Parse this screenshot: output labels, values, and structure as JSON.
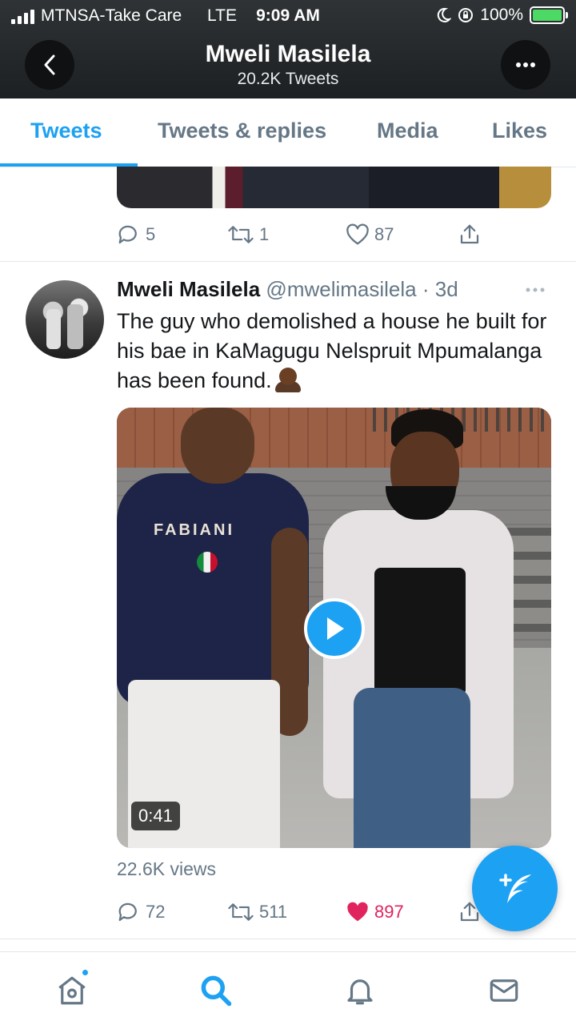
{
  "status_bar": {
    "carrier": "MTNSA-Take Care",
    "network": "LTE",
    "time": "9:09 AM",
    "battery": "100%"
  },
  "header": {
    "name": "Mweli Masilela",
    "tweet_count": "20.2K Tweets"
  },
  "tabs": [
    {
      "label": "Tweets",
      "active": true
    },
    {
      "label": "Tweets & replies",
      "active": false
    },
    {
      "label": "Media",
      "active": false
    },
    {
      "label": "Likes",
      "active": false
    }
  ],
  "previous_tweet": {
    "replies": "5",
    "retweets": "1",
    "likes": "87"
  },
  "tweet": {
    "author_name": "Mweli Masilela",
    "meta": "@mwelimasilela · 3d",
    "text": "The guy who demolished a house he built for his bae in KaMagugu Nelspruit Mpumalanga has been found.",
    "video": {
      "duration": "0:41",
      "shirt_brand": "FABIANI"
    },
    "views": "22.6K views",
    "replies": "72",
    "retweets": "511",
    "likes": "897",
    "liked": true
  },
  "colors": {
    "accent": "#1da1f2",
    "like": "#e0245e",
    "header_bg": "#26292b",
    "muted_text": "#657786"
  },
  "icons": {
    "nav": [
      "home-icon",
      "search-icon",
      "notifications-icon",
      "messages-icon"
    ],
    "compose": "compose-tweet-icon"
  }
}
